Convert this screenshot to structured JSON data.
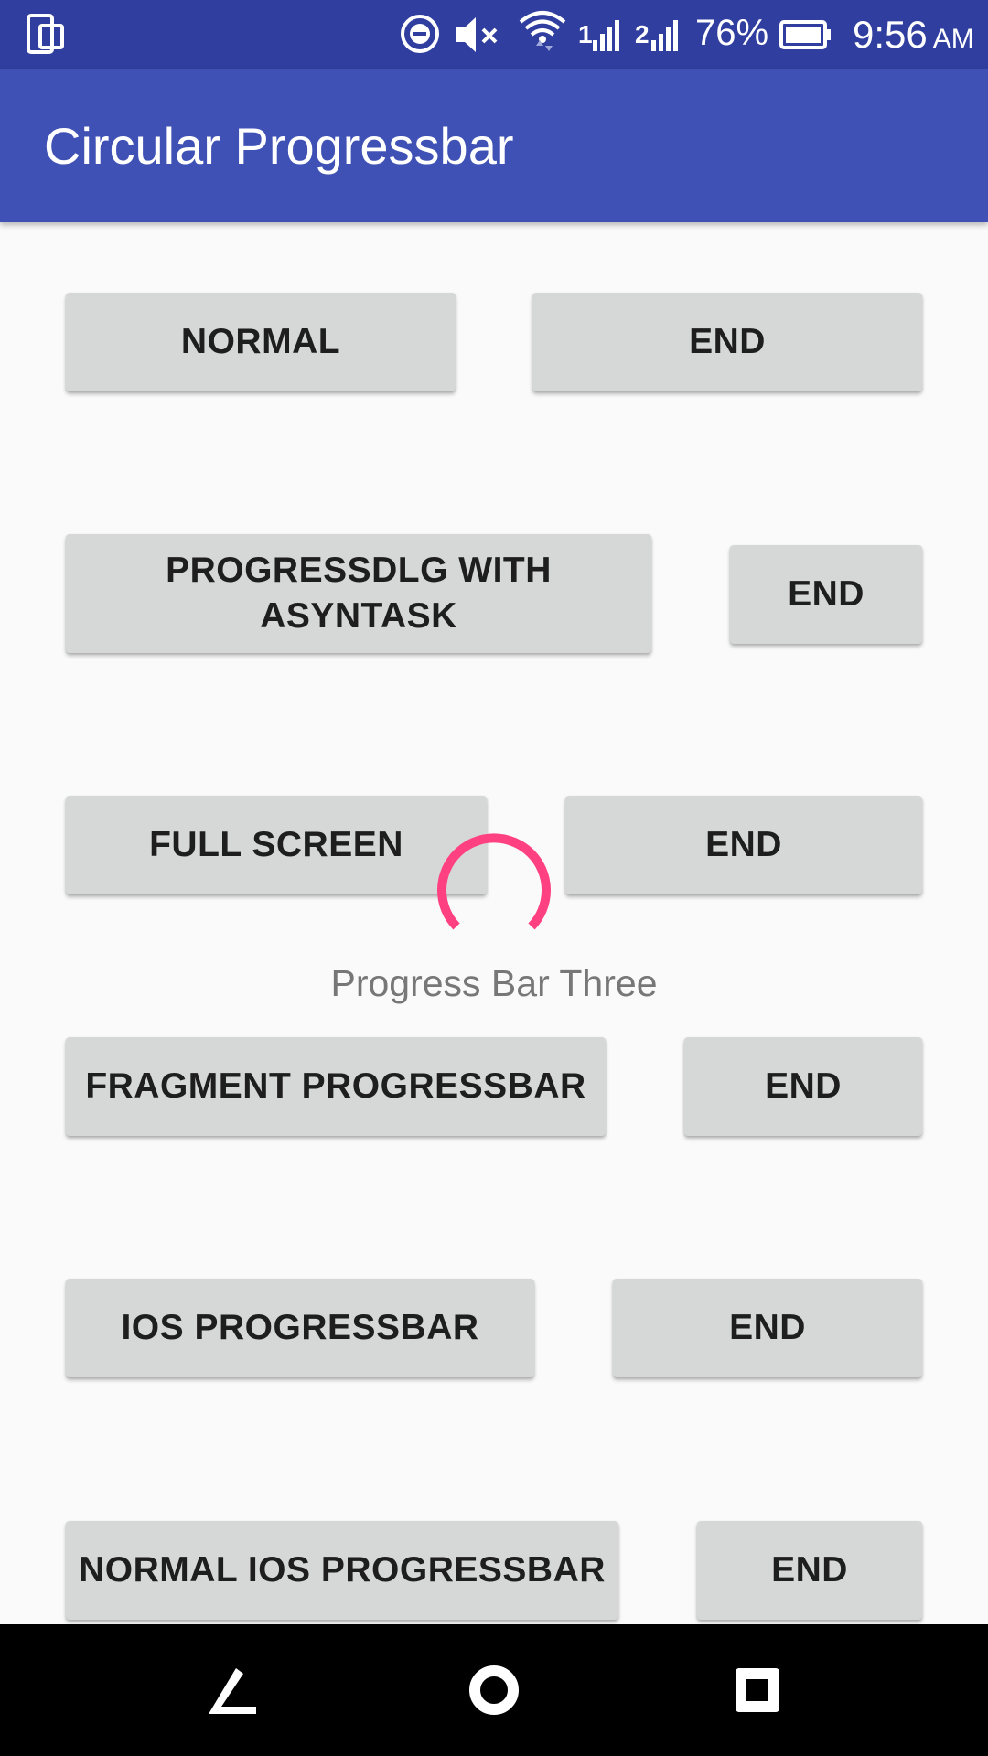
{
  "status_bar": {
    "battery_percent": "76%",
    "time": "9:56",
    "time_suffix": "AM",
    "sim1_label": "1",
    "sim2_label": "2",
    "icons": [
      "screen-rotate-icon",
      "do-not-disturb-icon",
      "volume-muted-icon",
      "wifi-icon",
      "signal-sim1-icon",
      "signal-sim2-icon",
      "battery-icon"
    ]
  },
  "toolbar": {
    "title": "Circular Progressbar"
  },
  "rows": [
    {
      "action_label": "NORMAL",
      "end_label": "END"
    },
    {
      "action_label": "PROGRESSDLG WITH ASYNTASK",
      "end_label": "END"
    },
    {
      "action_label": "FULL SCREEN",
      "end_label": "END"
    },
    {
      "action_label": "FRAGMENT PROGRESSBAR",
      "end_label": "END"
    },
    {
      "action_label": "IOS PROGRESSBAR",
      "end_label": "END"
    },
    {
      "action_label": "NORMAL IOS PROGRESSBAR",
      "end_label": "END"
    }
  ],
  "progress": {
    "label": "Progress Bar Three",
    "accent_color": "#ff4081"
  },
  "colors": {
    "status_bar": "#303f9f",
    "toolbar": "#3f51b5",
    "button": "#d6d7d7",
    "background": "#fafafa"
  },
  "nav_bar": {
    "icons": [
      "back-icon",
      "home-icon",
      "recents-icon"
    ]
  }
}
